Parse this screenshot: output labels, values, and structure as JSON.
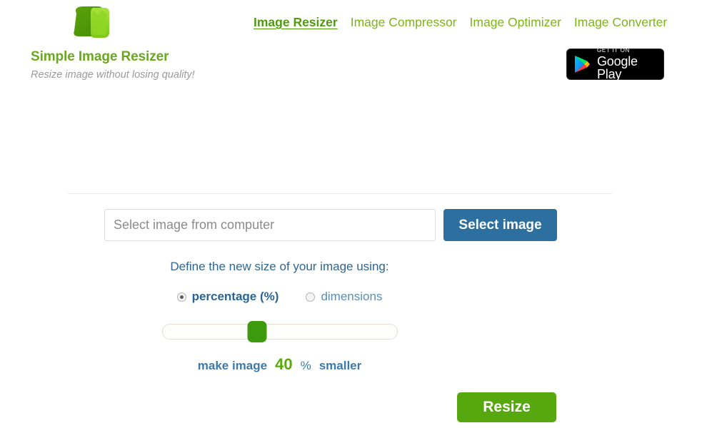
{
  "brand": {
    "name": "Simple Image Resizer",
    "tagline": "Resize image without losing quality!",
    "logo_icon": "green-arrow-logo",
    "name_color": "#6aa81e",
    "tagline_color": "#9a9a9a"
  },
  "nav": {
    "items": [
      {
        "label": "Image Resizer",
        "active": true
      },
      {
        "label": "Image Compressor",
        "active": false
      },
      {
        "label": "Image Optimizer",
        "active": false
      },
      {
        "label": "Image Converter",
        "active": false
      }
    ],
    "active_color": "#4e9c0c",
    "link_color": "#7cb518"
  },
  "google_play": {
    "superscript": "GET IT ON",
    "title": "Google Play",
    "icon": "google-play-triangle-icon",
    "background": "#000000"
  },
  "form": {
    "file_input": {
      "placeholder": "Select image from computer",
      "value": ""
    },
    "select_button": {
      "label": "Select image",
      "color": "#2d6f9e"
    },
    "define_label": "Define the new size of your image using:",
    "size_mode_options": [
      {
        "label": "percentage (%)",
        "selected": true
      },
      {
        "label": "dimensions",
        "selected": false
      }
    ],
    "slider": {
      "value": 40,
      "min": 0,
      "max": 100,
      "handle_color": "#3d9a0d"
    },
    "value_prefix": "make image",
    "value_number": "40",
    "value_unit": "%",
    "value_suffix": "smaller",
    "value_number_color": "#5aa90c",
    "resize_button": {
      "label": "Resize",
      "color": "#57a80f"
    }
  }
}
